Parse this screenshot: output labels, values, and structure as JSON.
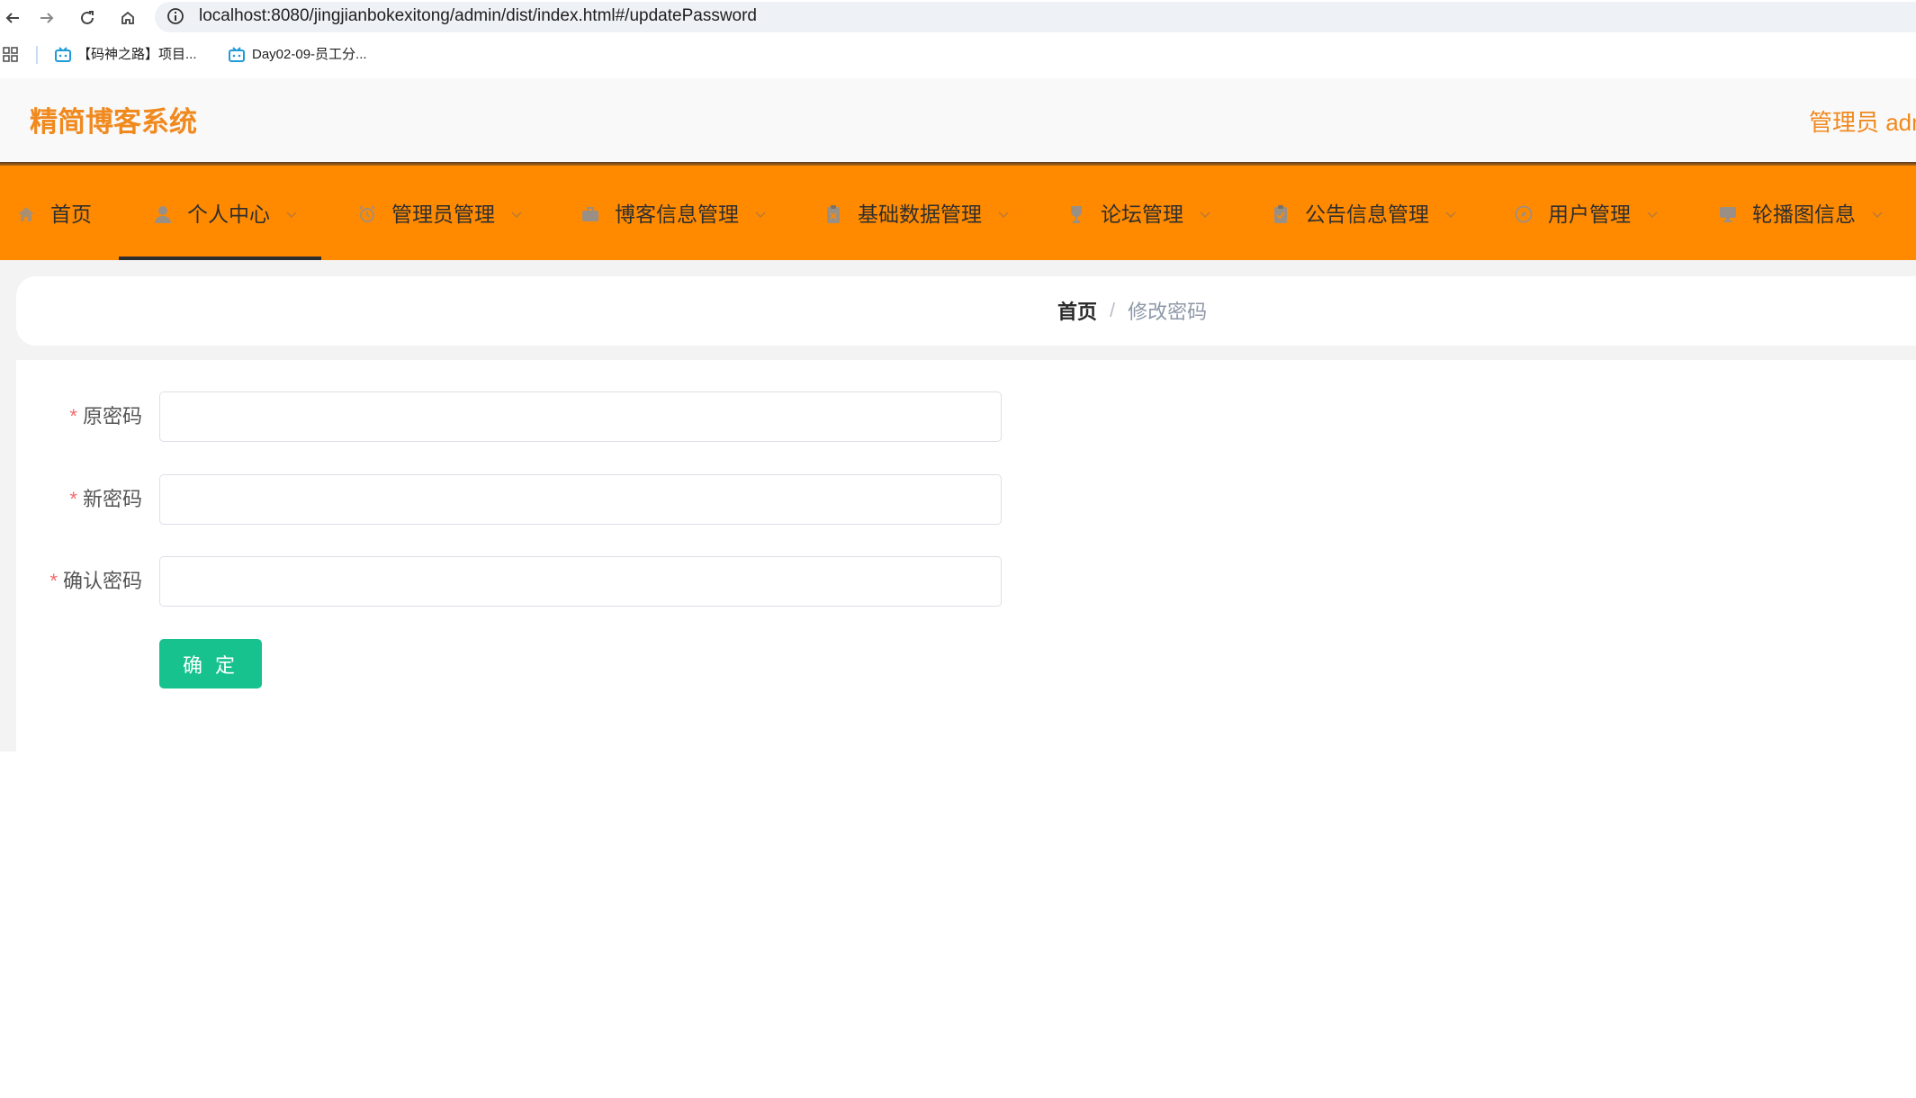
{
  "browser": {
    "url": "localhost:8080/jingjianbokexitong/admin/dist/index.html#/updatePassword",
    "nav_icons": [
      "back-icon",
      "forward-icon",
      "reload-icon",
      "home-icon",
      "info-icon"
    ]
  },
  "bookmarks": [
    {
      "label": "【码神之路】项目...",
      "icon": "bookmark-tv-icon"
    },
    {
      "label": "Day02-09-员工分...",
      "icon": "bookmark-tv-icon"
    }
  ],
  "header": {
    "title": "精简博客系统",
    "user": "管理员 adm"
  },
  "nav": {
    "items": [
      {
        "label": "首页",
        "icon": "home-icon",
        "dropdown": false
      },
      {
        "label": "个人中心",
        "icon": "user-icon",
        "dropdown": true,
        "active": true
      },
      {
        "label": "管理员管理",
        "icon": "alarm-icon",
        "dropdown": true
      },
      {
        "label": "博客信息管理",
        "icon": "briefcase-icon",
        "dropdown": true
      },
      {
        "label": "基础数据管理",
        "icon": "clipboard-icon",
        "dropdown": true
      },
      {
        "label": "论坛管理",
        "icon": "trophy-icon",
        "dropdown": true
      },
      {
        "label": "公告信息管理",
        "icon": "clipboard-check-icon",
        "dropdown": true
      },
      {
        "label": "用户管理",
        "icon": "compass-icon",
        "dropdown": true
      },
      {
        "label": "轮播图信息",
        "icon": "monitor-icon",
        "dropdown": true
      }
    ]
  },
  "breadcrumb": {
    "home": "首页",
    "separator": "/",
    "current": "修改密码"
  },
  "form": {
    "required_mark": "*",
    "fields": [
      {
        "label": "原密码",
        "value": "",
        "required": true
      },
      {
        "label": "新密码",
        "value": "",
        "required": true
      },
      {
        "label": "确认密码",
        "value": "",
        "required": true
      }
    ],
    "submit_label": "确 定"
  },
  "colors": {
    "brand": "#f0891e",
    "nav_bg": "#ff8a00",
    "button": "#17c28f",
    "required": "#f56c6c"
  }
}
